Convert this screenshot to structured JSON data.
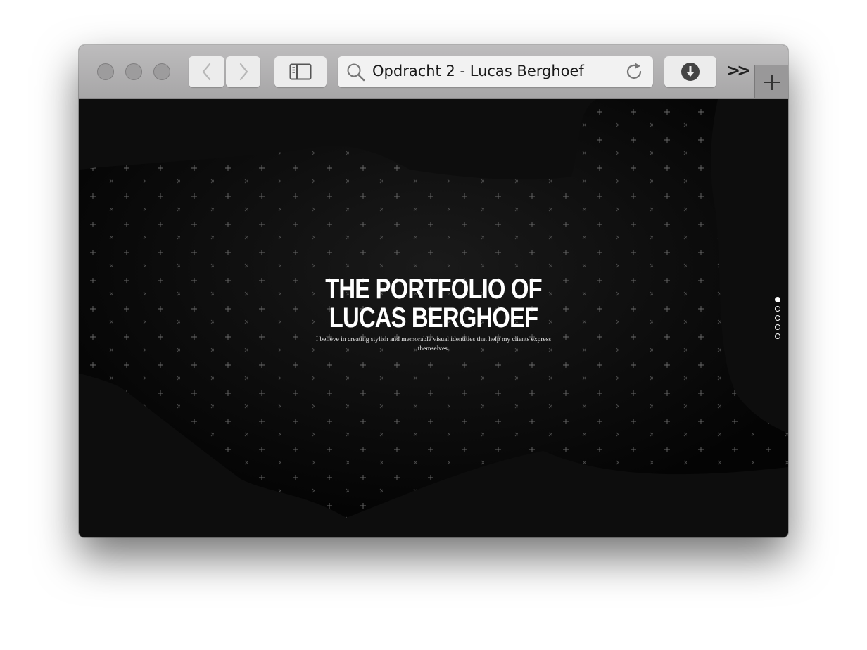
{
  "browser": {
    "address_text": "Opdracht 2 - Lucas Berghoef",
    "overflow_label": ">>",
    "new_tab_label": "+"
  },
  "page": {
    "title_line1": "THE PORTFOLIO OF",
    "title_line2": "LUCAS BERGHOEF",
    "subtitle": "I believe in creating stylish and memorable visual identities that help my clients express themselves.",
    "nav_dots": [
      {
        "active": true
      },
      {
        "active": false
      },
      {
        "active": false
      },
      {
        "active": false
      },
      {
        "active": false
      }
    ]
  },
  "colors": {
    "background": "#0d0d0d",
    "text": "#ffffff",
    "toolbar": "#b3b2b3"
  },
  "icons": [
    "back-icon",
    "forward-icon",
    "sidebar-icon",
    "search-icon",
    "reload-icon",
    "download-icon",
    "plus-icon"
  ]
}
